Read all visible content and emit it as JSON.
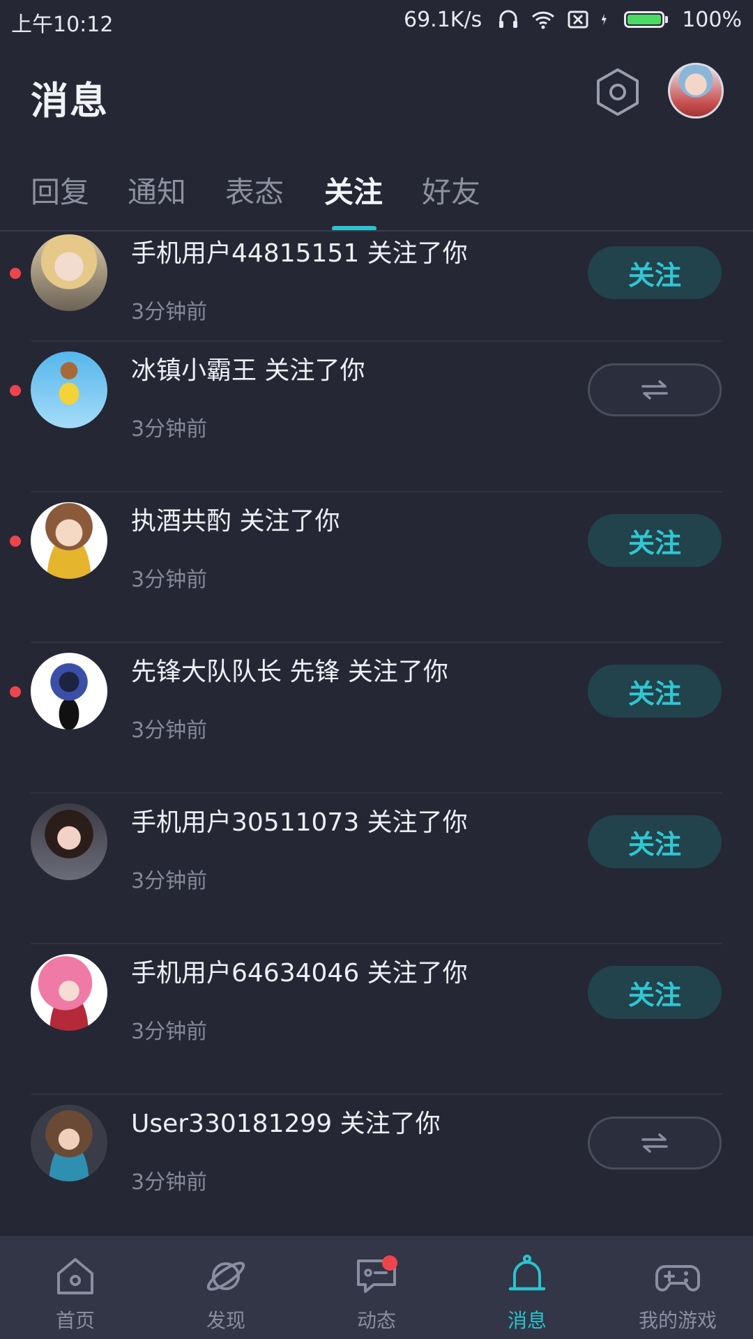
{
  "status_bar": {
    "time": "上午10:12",
    "net_speed": "69.1K/s",
    "battery_pct": "100%",
    "icons": [
      "headset-icon",
      "wifi-icon",
      "no-sim-icon",
      "charging-icon",
      "battery-icon"
    ]
  },
  "header": {
    "title": "消息",
    "settings_icon": "gear-icon",
    "avatar": "user-avatar"
  },
  "tabs": [
    {
      "label": "回复",
      "active": false
    },
    {
      "label": "通知",
      "active": false
    },
    {
      "label": "表态",
      "active": false
    },
    {
      "label": "关注",
      "active": true
    },
    {
      "label": "好友",
      "active": false
    }
  ],
  "rows": [
    {
      "name": "手机用户44815151 关注了你",
      "time": "3分钟前",
      "unread": true,
      "button": "关注",
      "mutual": false
    },
    {
      "name": "冰镇小霸王 关注了你",
      "time": "3分钟前",
      "unread": true,
      "button": "",
      "mutual": true
    },
    {
      "name": "执酒共酌 关注了你",
      "time": "3分钟前",
      "unread": true,
      "button": "关注",
      "mutual": false
    },
    {
      "name": "先锋大队队长 先锋 关注了你",
      "time": "3分钟前",
      "unread": true,
      "button": "关注",
      "mutual": false
    },
    {
      "name": "手机用户30511073 关注了你",
      "time": "3分钟前",
      "unread": false,
      "button": "关注",
      "mutual": false
    },
    {
      "name": "手机用户64634046 关注了你",
      "time": "3分钟前",
      "unread": false,
      "button": "关注",
      "mutual": false
    },
    {
      "name": "User330181299 关注了你",
      "time": "3分钟前",
      "unread": false,
      "button": "",
      "mutual": true
    }
  ],
  "bottom_nav": [
    {
      "label": "首页",
      "icon": "home-icon",
      "active": false
    },
    {
      "label": "发现",
      "icon": "planet-icon",
      "active": false
    },
    {
      "label": "动态",
      "icon": "chat-icon",
      "active": false,
      "badge": true
    },
    {
      "label": "消息",
      "icon": "bell-icon",
      "active": true
    },
    {
      "label": "我的游戏",
      "icon": "gamepad-icon",
      "active": false
    }
  ],
  "colors": {
    "background": "#252735",
    "accent": "#29c4cf",
    "unread_dot": "#f0444d",
    "nav_background": "#323646"
  }
}
